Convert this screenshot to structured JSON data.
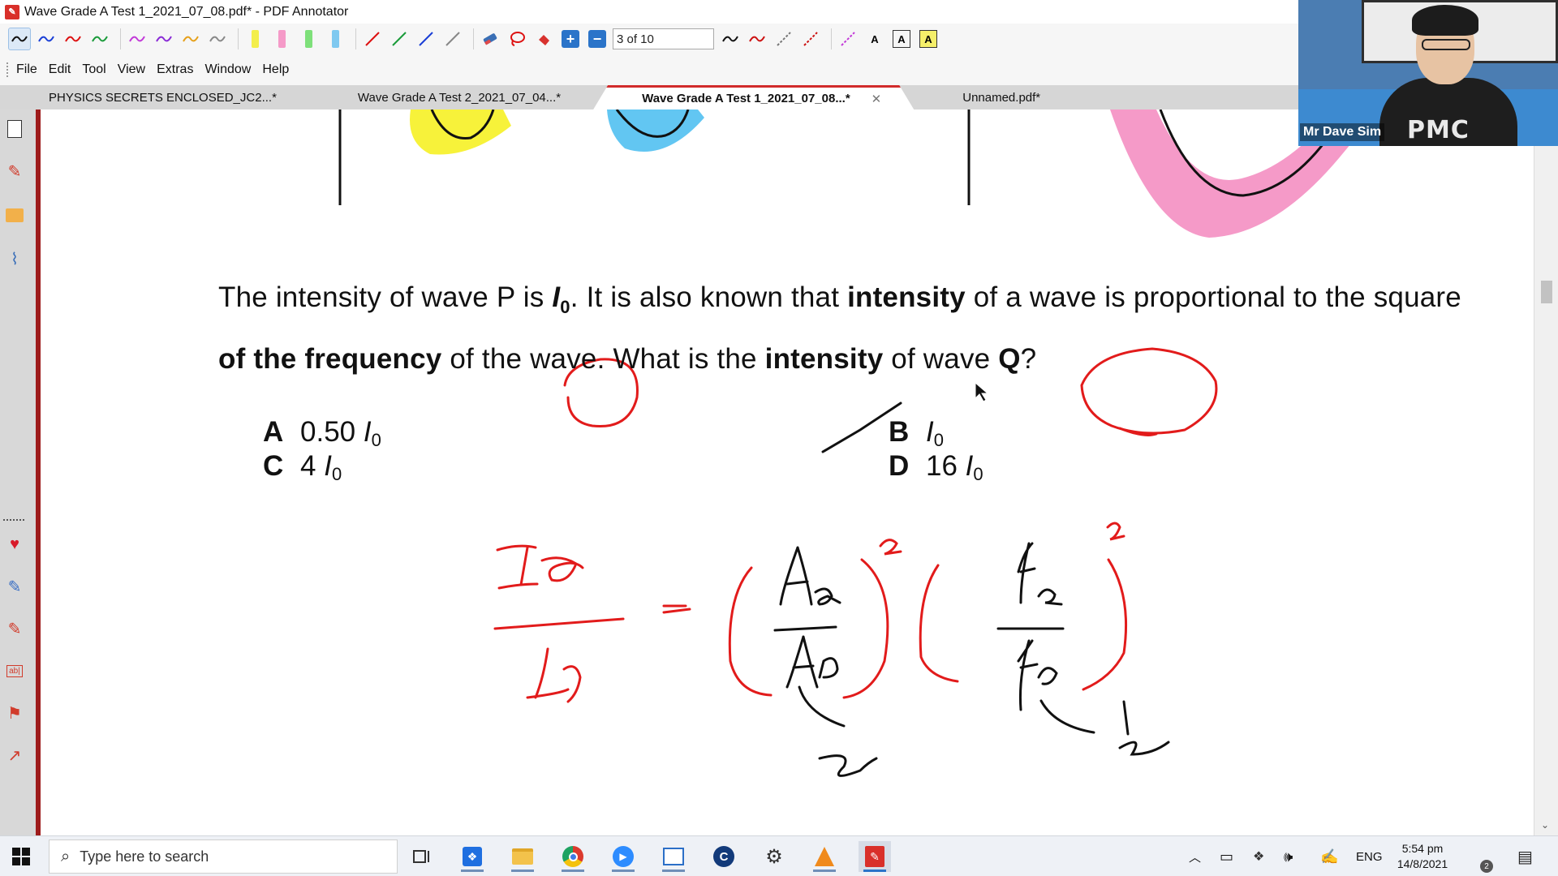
{
  "window": {
    "title": "Wave Grade A Test 1_2021_07_08.pdf* - PDF Annotator"
  },
  "toolbar": {
    "page_indicator": "3 of 10"
  },
  "menu": [
    "File",
    "Edit",
    "Tool",
    "View",
    "Extras",
    "Window",
    "Help"
  ],
  "tabs": [
    {
      "label": "PHYSICS SECRETS ENCLOSED_JC2...*",
      "active": false
    },
    {
      "label": "Wave Grade A Test 2_2021_07_04...*",
      "active": false
    },
    {
      "label": "Wave Grade A Test 1_2021_07_08...*",
      "active": true
    },
    {
      "label": "Unnamed.pdf*",
      "active": false
    }
  ],
  "document": {
    "question_parts": {
      "p1": "The intensity of wave P is ",
      "i0": "I",
      "sub0": "0",
      "p2": ". It is also known that ",
      "b1": "intensity",
      "p3": " of a wave is proportional to the square ",
      "b2": "of the frequency",
      "p4": " of the wave. What is the ",
      "b3": "intensity",
      "p5": " of wave ",
      "b4": "Q",
      "p6": "?"
    },
    "options": [
      {
        "letter": "A",
        "value": "0.50 ",
        "var": "I",
        "sub": "0"
      },
      {
        "letter": "B",
        "value": "",
        "var": "I",
        "sub": "0"
      },
      {
        "letter": "C",
        "value": "4 ",
        "var": "I",
        "sub": "0"
      },
      {
        "letter": "D",
        "value": "16 ",
        "var": "I",
        "sub": "0"
      }
    ],
    "ink_color": "#e21b1b",
    "pen_color": "#111111",
    "highlight_colors": {
      "yellow": "#f7f23a",
      "blue": "#62c6f2",
      "pink": "#f59ac8"
    }
  },
  "webcam": {
    "name_tag": "Mr Dave Sim",
    "hoodie_text": "PMC"
  },
  "taskbar": {
    "search_placeholder": "Type here to search",
    "lang": "ENG",
    "time": "5:54 pm",
    "date": "14/8/2021",
    "notification_count": "2"
  }
}
